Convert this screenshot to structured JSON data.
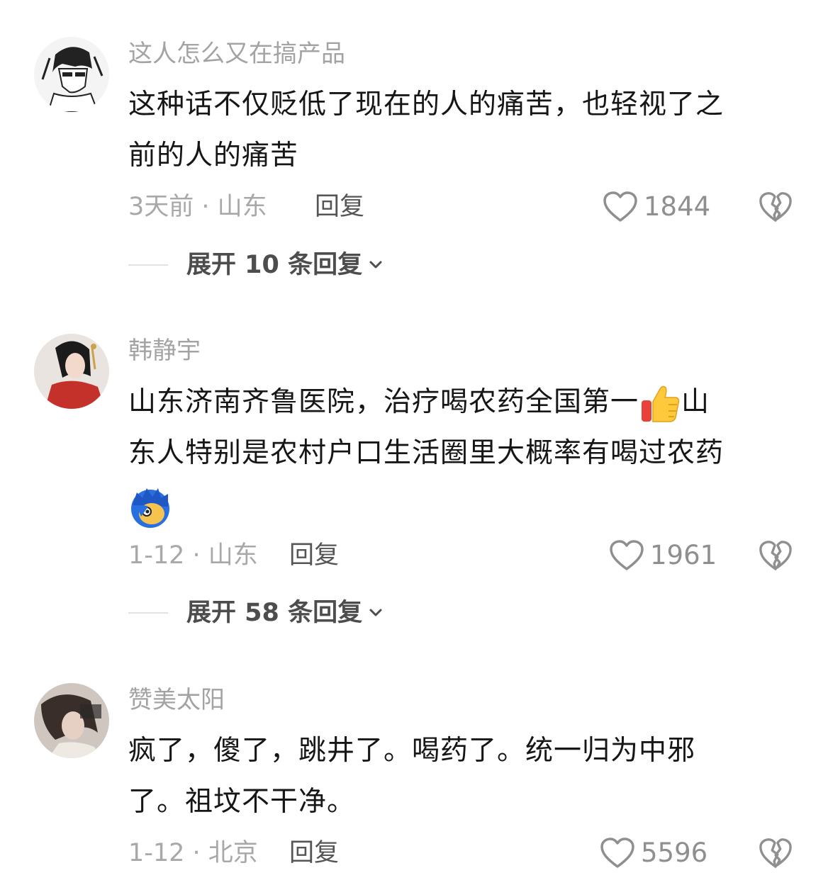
{
  "comments": [
    {
      "username": "这人怎么又在搞产品",
      "lines": [
        "这种话不仅贬低了现在的人的痛苦，也轻视了之",
        "前的人的痛苦"
      ],
      "time_location": "3天前 · 山东",
      "reply_label": "回复",
      "likes": "1844",
      "expand_label": "展开 10 条回复"
    },
    {
      "username": "韩静宇",
      "lines": [
        "山东济南齐鲁医院，治疗喝农药全国第一",
        "山",
        "东人特别是农村户口生活圈里大概率有喝过农药"
      ],
      "time_location": "1-12 · 山东",
      "reply_label": "回复",
      "likes": "1961",
      "expand_label": "展开 58 条回复"
    },
    {
      "username": "赞美太阳",
      "lines": [
        "疯了，傻了，跳井了。喝药了。统一归为中邪",
        "了。祖坟不干净。"
      ],
      "time_location": "1-12 · 北京",
      "reply_label": "回复",
      "likes": "5596"
    }
  ],
  "icons": {
    "like": "heart-outline-icon",
    "dislike": "broken-heart-icon",
    "expand": "chevron-down-icon",
    "thumbs_up_emoji": "thumbs-up-emoji",
    "blue_hair_emoji": "blue-hair-face-emoji"
  },
  "colors": {
    "username": "#a3a3a3",
    "text": "#161616",
    "meta": "#a8a8a8",
    "icon": "#8f8f8f"
  }
}
